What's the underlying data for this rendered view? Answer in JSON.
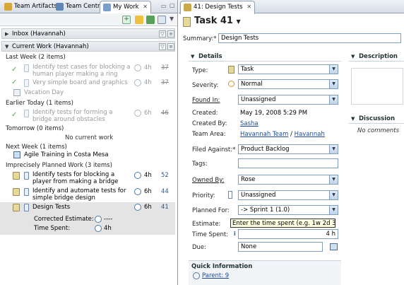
{
  "left_tabs": [
    {
      "label": "Team Artifacts",
      "icon": "team-artifacts-icon"
    },
    {
      "label": "Team Central",
      "icon": "team-central-icon"
    },
    {
      "label": "My Work",
      "icon": "my-work-icon"
    }
  ],
  "sections": {
    "inbox": "Inbox (Havannah)",
    "current_work": "Current Work (Havannah)"
  },
  "groups": {
    "last_week": "Last Week (2 items)",
    "earlier_today": "Earlier Today (1 items)",
    "tomorrow": "Tomorrow (0 items)",
    "next_week": "Next Week (1 items)",
    "imprecise": "Imprecisely Planned Work (3 items)"
  },
  "no_current_work": "No current work",
  "items": {
    "i1": {
      "title": "Identify test cases for blocking a human player making a ring",
      "hours": "4h",
      "id": "35"
    },
    "i2": {
      "title": "Very simple board and graphics",
      "hours": "4h",
      "id": "37"
    },
    "vacation": "Vacation Day",
    "i3": {
      "title": "Identify tests for forming a bridge around obstacles",
      "hours": "6h",
      "id": "46"
    },
    "training": "Agile Training in Costa Mesa",
    "i4": {
      "title": "Identify tests for blocking a player from making a bridge",
      "hours": "4h",
      "id": "52"
    },
    "i5": {
      "title": "Identify and automate tests for simple bridge design",
      "hours": "6h",
      "id": "44"
    },
    "i6": {
      "title": "Design Tests",
      "hours": "6h",
      "id": "41"
    },
    "corrected_estimate_label": "Corrected Estimate:",
    "corrected_estimate_value": "----",
    "time_spent_label": "Time Spent:",
    "time_spent_value": "4h"
  },
  "editor": {
    "tab": "41: Design Tests",
    "title": "Task 41",
    "summary_label": "Summary:*",
    "summary_value": "Design Tests",
    "details_header": "Details",
    "description_header": "Description",
    "discussion_header": "Discussion",
    "no_comments": "No comments",
    "type_label": "Type:",
    "type_value": "Task",
    "severity_label": "Severity:",
    "severity_value": "Normal",
    "found_in_label": "Found In:",
    "found_in_value": "Unassigned",
    "created_label": "Created:",
    "created_value": "May 19, 2008 5:29 PM",
    "created_by_label": "Created By:",
    "created_by_value": "Sasha",
    "team_area_label": "Team Area:",
    "team_area_value1": "Havannah Team",
    "team_area_sep": "/",
    "team_area_value2": "Havannah",
    "filed_against_label": "Filed Against:*",
    "filed_against_value": "Product Backlog",
    "tags_label": "Tags:",
    "tags_value": "",
    "owned_by_label": "Owned By:",
    "owned_by_value": "Rose",
    "priority_label": "Priority:",
    "priority_value": "Unassigned",
    "planned_for_label": "Planned For:",
    "planned_for_value": "-> Sprint 1 (1.0)",
    "estimate_label": "Estimate:",
    "estimate_tooltip": "Enter the time spent (e.g. 1w 2d 3h 4m)",
    "time_spent_label": "Time Spent:",
    "time_spent_value": "4 h",
    "due_label": "Due:",
    "due_value": "None",
    "quick_info_header": "Quick Information",
    "parent_label": "Parent: 9"
  }
}
